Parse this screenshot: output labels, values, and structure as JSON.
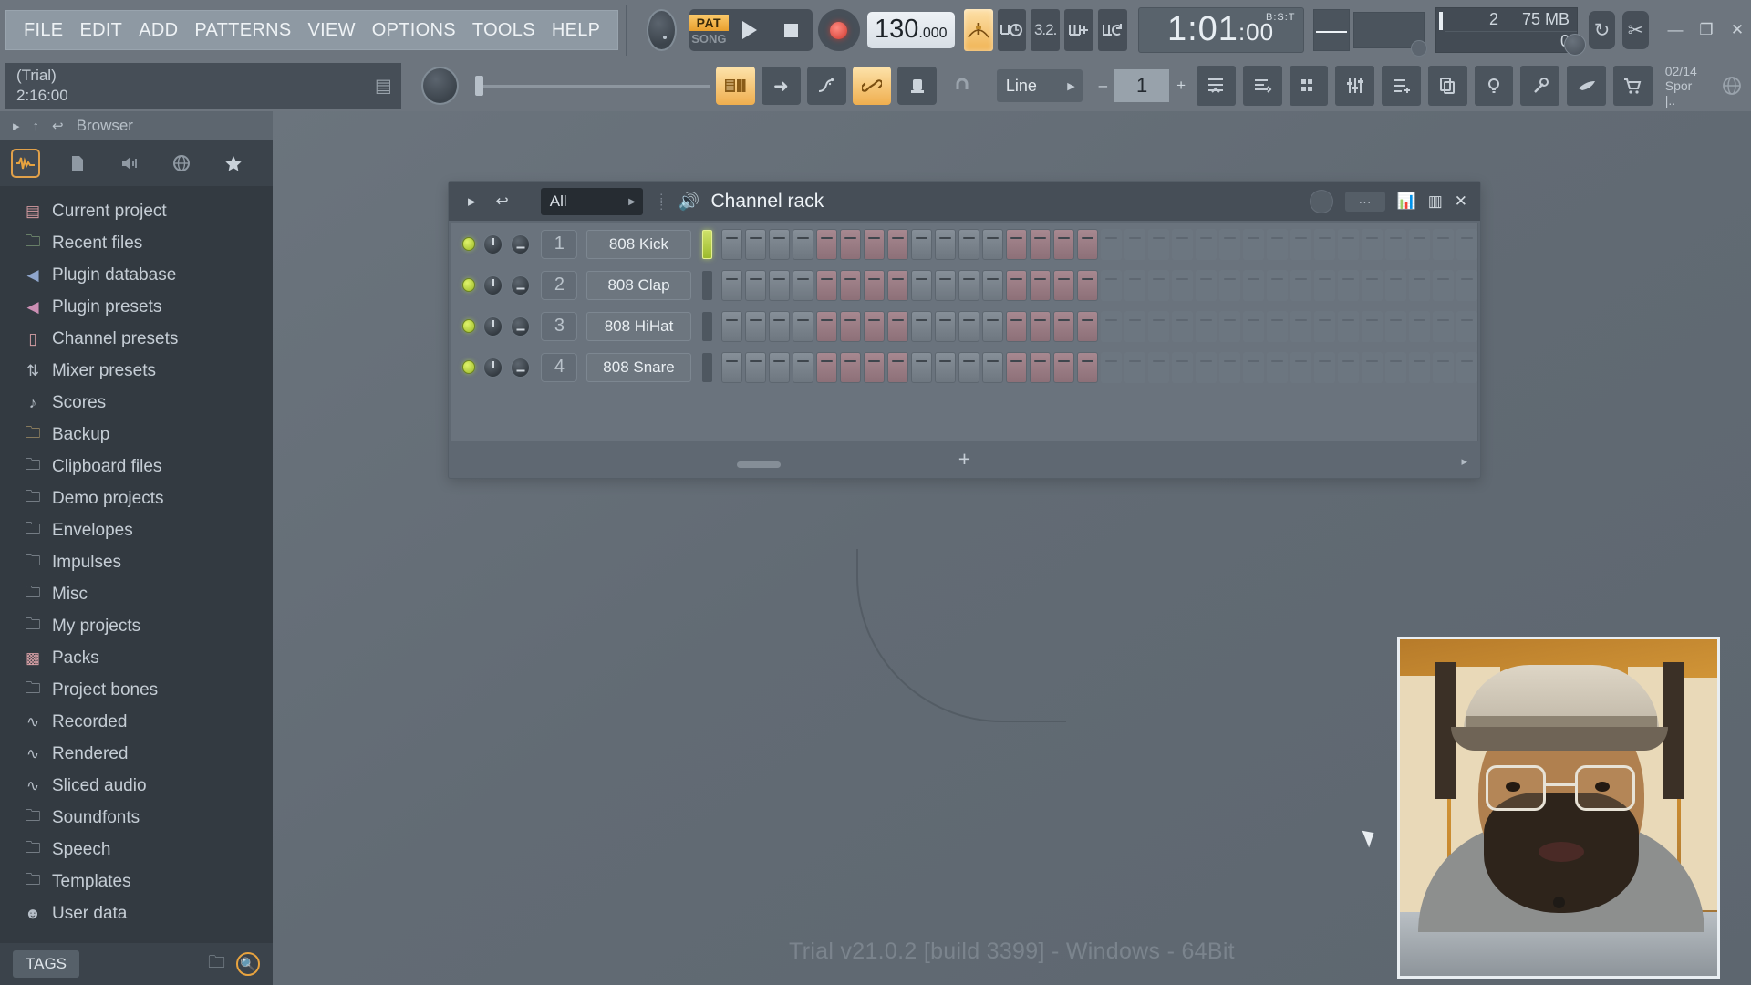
{
  "menu": {
    "items": [
      "FILE",
      "EDIT",
      "ADD",
      "PATTERNS",
      "VIEW",
      "OPTIONS",
      "TOOLS",
      "HELP"
    ]
  },
  "transport": {
    "pat_label": "PAT",
    "song_label": "SONG",
    "tempo_int": "130",
    "tempo_dec": ".000",
    "time_display": "1:01",
    "time_ticks": ":00",
    "time_unit": "B:S:T",
    "play_icon": "play-icon",
    "stop_icon": "stop-icon",
    "record_icon": "record-icon",
    "metronome_icon": "metronome-icon",
    "wait_icon": "wait-for-input-icon",
    "countdown_icon": "countdown-icon",
    "stepedit_icon": "step-edit-icon",
    "loop_icon": "pattern-loop-icon"
  },
  "status": {
    "voices": "2",
    "memory": "75 MB",
    "extra": "0"
  },
  "window": {
    "minimize": "—",
    "maximize": "❐",
    "close": "✕"
  },
  "project": {
    "trial_label": "(Trial)",
    "time_elapsed": "2:16:00"
  },
  "toolbar2": {
    "snap_value": "Line",
    "pattern_number": "1",
    "minus": "–",
    "plus": "+",
    "date": "02/14",
    "user": "Spor |.."
  },
  "browser": {
    "title": "Browser",
    "tags_label": "TAGS",
    "items": [
      {
        "label": "Current project",
        "icon": "page-icon",
        "color": "#d49aa0"
      },
      {
        "label": "Recent files",
        "icon": "folder-icon",
        "color": "#9ec48f"
      },
      {
        "label": "Plugin database",
        "icon": "speaker-icon",
        "color": "#8fa6cd"
      },
      {
        "label": "Plugin presets",
        "icon": "speaker-icon",
        "color": "#cc8fb4"
      },
      {
        "label": "Channel presets",
        "icon": "channel-icon",
        "color": "#d8a0a6"
      },
      {
        "label": "Mixer presets",
        "icon": "mixer-icon",
        "color": "#b6bec7"
      },
      {
        "label": "Scores",
        "icon": "note-icon",
        "color": "#b6bec7"
      },
      {
        "label": "Backup",
        "icon": "folder-icon",
        "color": "#d8b878"
      },
      {
        "label": "Clipboard files",
        "icon": "folder-icon",
        "color": "#b6bec7"
      },
      {
        "label": "Demo projects",
        "icon": "folder-icon",
        "color": "#b6bec7"
      },
      {
        "label": "Envelopes",
        "icon": "folder-icon",
        "color": "#b6bec7"
      },
      {
        "label": "Impulses",
        "icon": "folder-icon",
        "color": "#b6bec7"
      },
      {
        "label": "Misc",
        "icon": "folder-icon",
        "color": "#b6bec7"
      },
      {
        "label": "My projects",
        "icon": "folder-icon",
        "color": "#b6bec7"
      },
      {
        "label": "Packs",
        "icon": "packs-icon",
        "color": "#d8a0a6"
      },
      {
        "label": "Project bones",
        "icon": "folder-icon",
        "color": "#b6bec7"
      },
      {
        "label": "Recorded",
        "icon": "wave-icon",
        "color": "#b6bec7"
      },
      {
        "label": "Rendered",
        "icon": "wave-icon",
        "color": "#b6bec7"
      },
      {
        "label": "Sliced audio",
        "icon": "wave-icon",
        "color": "#b6bec7"
      },
      {
        "label": "Soundfonts",
        "icon": "folder-icon",
        "color": "#b6bec7"
      },
      {
        "label": "Speech",
        "icon": "folder-icon",
        "color": "#b6bec7"
      },
      {
        "label": "Templates",
        "icon": "folder-icon",
        "color": "#b6bec7"
      },
      {
        "label": "User data",
        "icon": "user-icon",
        "color": "#b6bec7"
      }
    ]
  },
  "channel_rack": {
    "title": "Channel rack",
    "filter_value": "All",
    "add_label": "+",
    "channels": [
      {
        "number": "1",
        "name": "808 Kick",
        "led": "on",
        "activity": "hot",
        "steps": [
          "a",
          "a",
          "a",
          "a",
          "b",
          "b",
          "b",
          "b",
          "a",
          "a",
          "a",
          "a",
          "b",
          "b",
          "b",
          "b",
          "off",
          "off",
          "off",
          "off",
          "off",
          "off",
          "off",
          "off",
          "off",
          "off",
          "off",
          "off",
          "off",
          "off",
          "off",
          "off"
        ]
      },
      {
        "number": "2",
        "name": "808 Clap",
        "led": "on",
        "activity": "idle",
        "steps": [
          "a",
          "a",
          "a",
          "a",
          "b",
          "b",
          "b",
          "b",
          "a",
          "a",
          "a",
          "a",
          "b",
          "b",
          "b",
          "b",
          "off",
          "off",
          "off",
          "off",
          "off",
          "off",
          "off",
          "off",
          "off",
          "off",
          "off",
          "off",
          "off",
          "off",
          "off",
          "off"
        ]
      },
      {
        "number": "3",
        "name": "808 HiHat",
        "led": "on",
        "activity": "idle",
        "steps": [
          "a",
          "a",
          "a",
          "a",
          "b",
          "b",
          "b",
          "b",
          "a",
          "a",
          "a",
          "a",
          "b",
          "b",
          "b",
          "b",
          "off",
          "off",
          "off",
          "off",
          "off",
          "off",
          "off",
          "off",
          "off",
          "off",
          "off",
          "off",
          "off",
          "off",
          "off",
          "off"
        ]
      },
      {
        "number": "4",
        "name": "808 Snare",
        "led": "on",
        "activity": "idle",
        "steps": [
          "a",
          "a",
          "a",
          "a",
          "b",
          "b",
          "b",
          "b",
          "a",
          "a",
          "a",
          "a",
          "b",
          "b",
          "b",
          "b",
          "off",
          "off",
          "off",
          "off",
          "off",
          "off",
          "off",
          "off",
          "off",
          "off",
          "off",
          "off",
          "off",
          "off",
          "off",
          "off"
        ]
      }
    ]
  },
  "footer": {
    "trial_text": "Trial v21.0.2 [build 3399] - Windows - 64Bit"
  },
  "colors": {
    "accent": "#e8a33f",
    "led_green": "#b4dc46",
    "background": "#626b75"
  }
}
